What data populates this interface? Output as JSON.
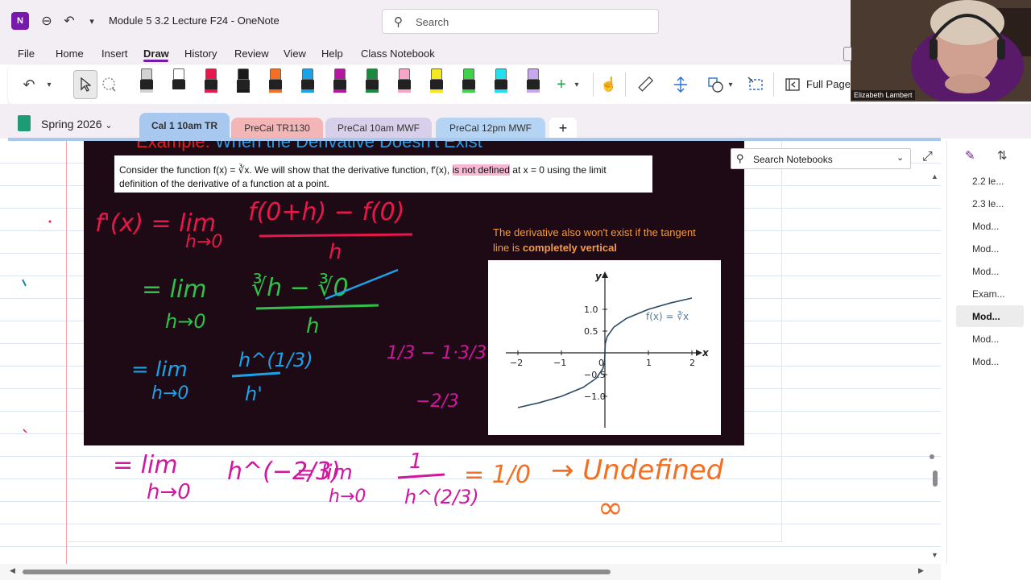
{
  "titlebar": {
    "doc_title": "Module 5 3.2 Lecture F24 - OneNote",
    "search_placeholder": "Search",
    "app_logo": "N"
  },
  "menu": {
    "items": [
      "File",
      "Home",
      "Insert",
      "Draw",
      "History",
      "Review",
      "View",
      "Help",
      "Class Notebook"
    ],
    "active": "Draw"
  },
  "ribbon": {
    "full_page_label": "Full Page",
    "pen_colors": [
      "#d2d2d2",
      "#ffffff",
      "#e8174c",
      "#1a1a1a",
      "#f37022",
      "#1aa3e8",
      "#b5179e",
      "#1a8a3c",
      "#f7a6c9",
      "#f4e91e",
      "#3ed14a",
      "#21e0f0",
      "#c9a7f0"
    ]
  },
  "notebook": {
    "name": "Spring 2026",
    "sections": [
      {
        "label": "Cal 1 10am TR",
        "color": "#a8c8f0",
        "active": true
      },
      {
        "label": "PreCal TR1130",
        "color": "#f3b5b5",
        "active": false
      },
      {
        "label": "PreCal 10am MWF",
        "color": "#d8d0ea",
        "active": false
      },
      {
        "label": "PreCal 12pm MWF",
        "color": "#b5d3f3",
        "active": false
      }
    ],
    "add_section": "+"
  },
  "slide": {
    "title_red": "Example:",
    "title_blue": "When the Derivative Doesn't Exist",
    "statement_part1": "Consider the function f(x) = ∛x. We will show that the derivative function, f′(x),",
    "statement_highlight": "is not defined",
    "statement_part2": "at x = 0 using the limit definition of the derivative of a function at a point.",
    "note_line1": "The derivative also won't exist if the tangent line is ",
    "note_bold": "completely vertical"
  },
  "chart_data": {
    "type": "line",
    "function_label": "f(x) = ∛x",
    "xlabel": "x",
    "ylabel": "y",
    "xlim": [
      -2.2,
      2.2
    ],
    "ylim": [
      -1.4,
      1.4
    ],
    "x_ticks": [
      "−2",
      "−1",
      "0",
      "1",
      "2"
    ],
    "y_ticks": [
      "1.0",
      "0.5",
      "−0.5",
      "−1.0"
    ],
    "series": [
      {
        "x": [
          -2,
          -1.5,
          -1,
          -0.5,
          -0.2,
          -0.05,
          -0.01,
          0,
          0.01,
          0.05,
          0.2,
          0.5,
          1,
          1.5,
          2
        ],
        "y": [
          -1.26,
          -1.145,
          -1.0,
          -0.794,
          -0.585,
          -0.368,
          -0.215,
          0,
          0.215,
          0.368,
          0.585,
          0.794,
          1.0,
          1.145,
          1.26
        ]
      }
    ]
  },
  "handwriting": {
    "step1_left": "f'(x) = lim",
    "step1_sub": "h→0",
    "step1_num": "f(0+h) − f(0)",
    "step1_den": "h",
    "step2_lim": "= lim",
    "step2_sub": "h→0",
    "step2_num": "∛h − ∛0",
    "step2_den": "h",
    "step3_lim": "= lim",
    "step3_sub": "h→0",
    "step3_num": "h^(1/3)",
    "step3_den": "h'",
    "side_calc1": "1/3 − 1·3/3",
    "side_calc2": "−2/3",
    "step4_lim": "= lim",
    "step4_sub": "h→0",
    "step4_expr": "h^(−2/3)",
    "step4_lim2": "= lim",
    "step4_sub2": "h→0",
    "step4_frac_num": "1",
    "step4_frac_den": "h^(2/3)",
    "step4_eq": "= 1/0",
    "result": "→ Undefined",
    "infinity": "∞"
  },
  "right_pane": {
    "search_label": "Search Notebooks",
    "pages": [
      "2.2 le...",
      "2.3 le...",
      "Mod...",
      "Mod...",
      "Mod...",
      "Exam...",
      "Mod...",
      "Mod...",
      "Mod..."
    ],
    "active_index": 6
  },
  "webcam": {
    "name": "Elizabeth Lambert"
  }
}
